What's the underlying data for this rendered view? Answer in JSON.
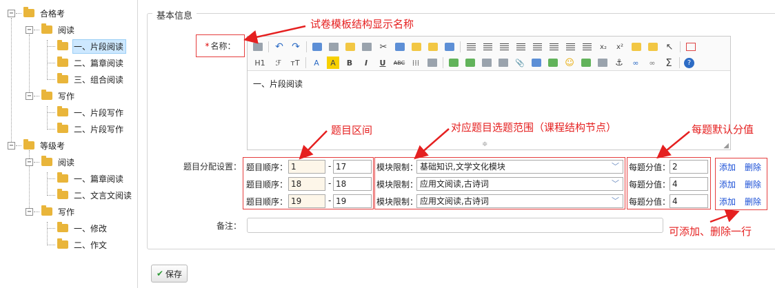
{
  "tree": {
    "nodes": [
      {
        "label": "合格考",
        "level": 0,
        "toggle": "−"
      },
      {
        "label": "阅读",
        "level": 1,
        "toggle": "−"
      },
      {
        "label": "一、片段阅读",
        "level": 2,
        "selected": true
      },
      {
        "label": "二、篇章阅读",
        "level": 2
      },
      {
        "label": "三、组合阅读",
        "level": 2
      },
      {
        "label": "写作",
        "level": 1,
        "toggle": "−"
      },
      {
        "label": "一、片段写作",
        "level": 2
      },
      {
        "label": "二、片段写作",
        "level": 2
      },
      {
        "label": "等级考",
        "level": 0,
        "toggle": "−"
      },
      {
        "label": "阅读",
        "level": 1,
        "toggle": "−"
      },
      {
        "label": "一、篇章阅读",
        "level": 2
      },
      {
        "label": "二、文言文阅读",
        "level": 2
      },
      {
        "label": "写作",
        "level": 1,
        "toggle": "−"
      },
      {
        "label": "一、修改",
        "level": 2
      },
      {
        "label": "二、作文",
        "level": 2
      }
    ]
  },
  "form": {
    "legend": "基本信息",
    "name_required_mark": "*",
    "name_label": "名称：",
    "editor_content": "一、片段阅读",
    "toolbar_row2_text": [
      "H1",
      "A",
      "A",
      "B",
      "I",
      "U",
      "ABC",
      "Σ"
    ],
    "allocation_label": "题目分配设置：",
    "order_label": "题目顺序：",
    "dash": "-",
    "module_label": "模块限制：",
    "score_label": "每题分值：",
    "add_label": "添加",
    "delete_label": "删除",
    "note_label": "备注：",
    "note_value": "",
    "rows": [
      {
        "from": "1",
        "to": "17",
        "module": "基础知识,文学文化模块",
        "score": "2"
      },
      {
        "from": "18",
        "to": "18",
        "module": "应用文阅读,古诗词",
        "score": "4"
      },
      {
        "from": "19",
        "to": "19",
        "module": "应用文阅读,古诗词",
        "score": "4"
      }
    ],
    "save_label": "保存"
  },
  "annotations": {
    "name_hint": "试卷模板结构显示名称",
    "range_hint": "题目区间",
    "scope_hint": "对应题目选题范围（课程结构节点）",
    "score_hint": "每题默认分值",
    "row_hint": "可添加、删除一行"
  },
  "colors": {
    "annotation": "#e52020",
    "link": "#1a4fd6",
    "folder": "#e9b53a",
    "selected": "#cde8ff"
  }
}
